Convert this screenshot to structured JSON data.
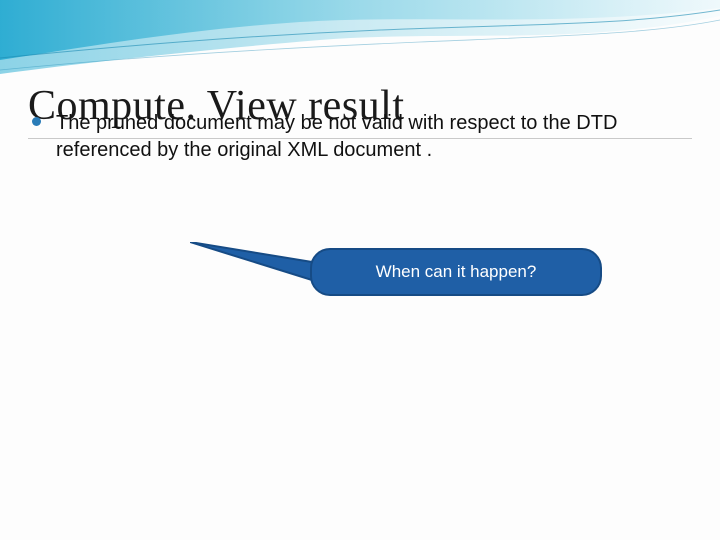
{
  "title": "Compute. View result",
  "bullet": "The pruned document may be not valid with respect to the DTD referenced by the original XML document .",
  "callout": "When can it happen?",
  "colors": {
    "accent": "#1f5fa6",
    "bullet_dot": "#2a7cb8"
  }
}
